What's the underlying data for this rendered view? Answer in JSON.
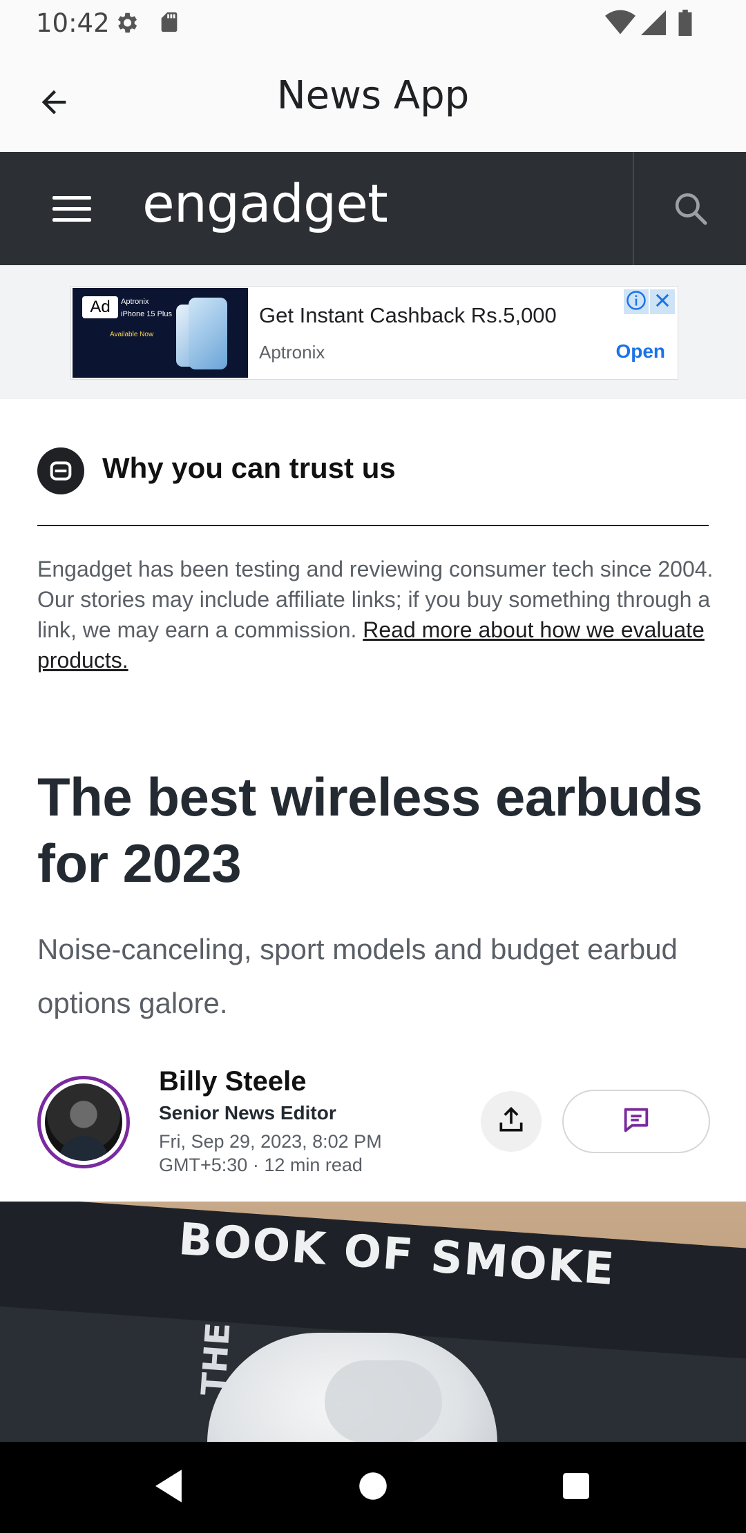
{
  "status_bar": {
    "time": "10:42",
    "icons": [
      "settings-icon",
      "sd-card-icon",
      "wifi-icon",
      "signal-icon",
      "battery-icon"
    ]
  },
  "app_bar": {
    "title": "News App",
    "back_icon": "arrow-back-icon"
  },
  "site_header": {
    "logo": "engadget",
    "menu_icon": "hamburger-menu-icon",
    "search_icon": "search-icon",
    "background": "#2c2f34"
  },
  "ad": {
    "badge": "Ad",
    "headline": "Get Instant Cashback Rs.5,000",
    "advertiser": "Aptronix",
    "cta": "Open",
    "image_text_1": "Aptronix",
    "image_text_2": "iPhone 15 Plus",
    "image_text_3": "Available Now",
    "info_icon": "info-icon",
    "close_icon": "close-icon"
  },
  "trust": {
    "title": "Why you can trust us",
    "body": "Engadget has been testing and reviewing consumer tech since 2004. Our stories may include affiliate links; if you buy something through a link, we may earn a commission. ",
    "link": "Read more about how we evaluate products."
  },
  "article": {
    "headline": "The best wireless earbuds for 2023",
    "subhead": "Noise-canceling, sport models and budget earbud options galore.",
    "author": {
      "name": "Billy Steele",
      "role": "Senior News Editor",
      "date": "Fri, Sep 29, 2023, 8:02 PM",
      "timezone": "GMT+5:30",
      "separator": "·",
      "read_time": "12 min read"
    },
    "hero_image": {
      "book_title": "BOOK OF SMOKE",
      "book_spine": "THE"
    }
  },
  "colors": {
    "accent_purple": "#7a2a9e",
    "link_blue": "#1a73e8"
  },
  "nav_bar": {
    "icons": [
      "back-triangle-icon",
      "home-circle-icon",
      "recents-square-icon"
    ]
  }
}
